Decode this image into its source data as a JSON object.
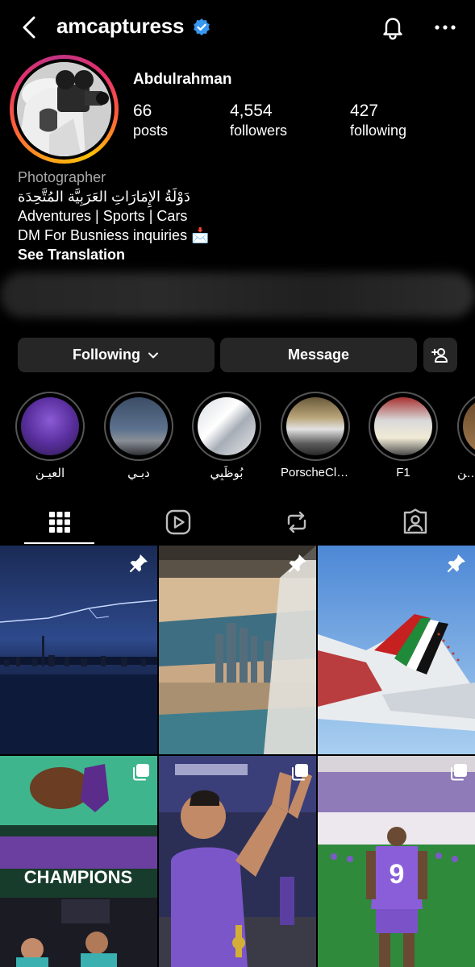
{
  "header": {
    "username": "amcapturess",
    "verified": true,
    "icons": [
      "back-arrow-icon",
      "verified-badge-icon",
      "bell-icon",
      "more-icon"
    ]
  },
  "profile": {
    "display_name": "Abdulrahman",
    "stats": [
      {
        "value": "66",
        "label": "posts"
      },
      {
        "value": "4,554",
        "label": "followers"
      },
      {
        "value": "427",
        "label": "following"
      }
    ],
    "bio": {
      "category": "Photographer",
      "arabic": "دَوْلَةُ الإِمَارَاتِ العَرَبِيَّة المُتَّحِدَة",
      "line1": "Adventures | Sports | Cars",
      "line2": "DM For Busniess inquiries 📩",
      "translation": "See Translation"
    }
  },
  "actions": {
    "following_label": "Following",
    "message_label": "Message"
  },
  "highlights": [
    {
      "label": "العيـن"
    },
    {
      "label": "دبـي"
    },
    {
      "label": "بُوظَبِي"
    },
    {
      "label": "PorscheCla..."
    },
    {
      "label": "F1"
    },
    {
      "label": "سن"
    }
  ],
  "tabs": [
    "grid-icon",
    "reels-icon",
    "tagged-repost-icon",
    "tagged-user-icon"
  ],
  "posts": [
    {
      "pinned": true,
      "multi": false,
      "scene": "lightning-city"
    },
    {
      "pinned": true,
      "multi": false,
      "scene": "aerial-towers"
    },
    {
      "pinned": true,
      "multi": false,
      "scene": "airplane-tail"
    },
    {
      "pinned": false,
      "multi": true,
      "scene": "champions"
    },
    {
      "pinned": false,
      "multi": true,
      "scene": "player-clapping"
    },
    {
      "pinned": false,
      "multi": true,
      "scene": "player-9"
    }
  ],
  "post_texts": {
    "champions": "CHAMPIONS",
    "jersey_number": "9"
  },
  "colors": {
    "background": "#000000",
    "button": "#262626",
    "verified": "#3897f0",
    "muted_text": "#a8a8a8"
  }
}
